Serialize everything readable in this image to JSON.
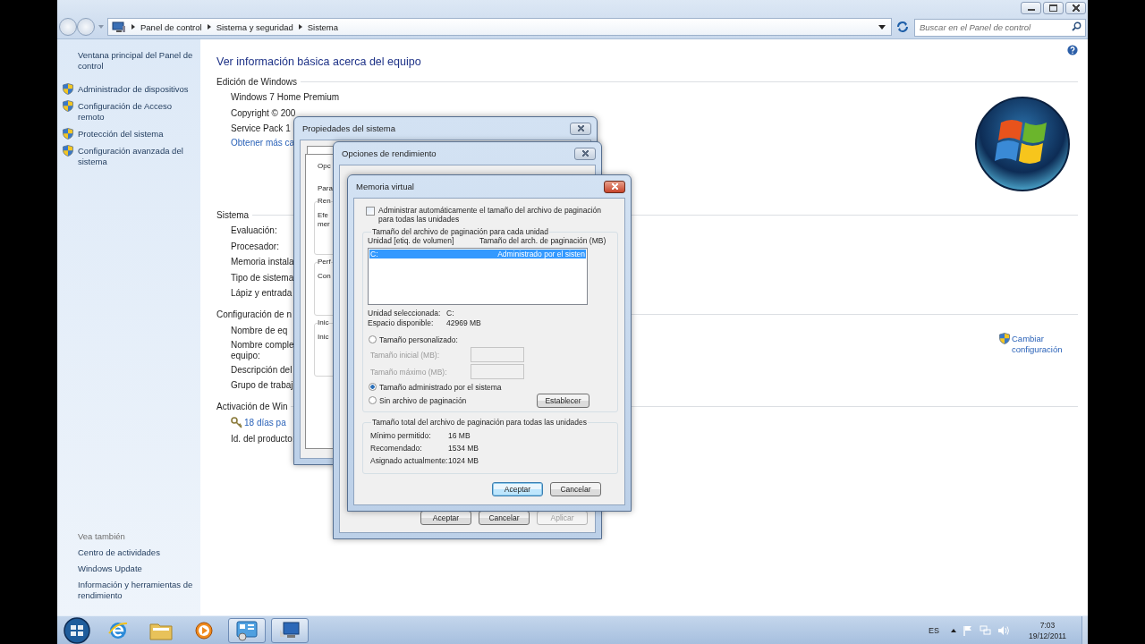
{
  "explorer": {
    "breadcrumb": [
      "Panel de control",
      "Sistema y seguridad",
      "Sistema"
    ],
    "search": {
      "placeholder": "Buscar en el Panel de control"
    }
  },
  "sidebar": {
    "home": "Ventana principal del Panel de control",
    "tasks": [
      "Administrador de dispositivos",
      "Configuración de Acceso remoto",
      "Protección del sistema",
      "Configuración avanzada del sistema"
    ],
    "see_also_title": "Vea también",
    "see_also": [
      "Centro de actividades",
      "Windows Update",
      "Información y herramientas de rendimiento"
    ]
  },
  "main": {
    "title": "Ver información básica acerca del equipo",
    "sections": [
      {
        "kind": "edition",
        "heading": "Edición de Windows",
        "rows": [
          {
            "kind": "text",
            "text": "Windows 7 Home Premium"
          },
          {
            "kind": "text",
            "text": "Copyright © 200"
          },
          {
            "kind": "text",
            "text": "Service Pack 1"
          },
          {
            "kind": "link",
            "text": "Obtener más ca"
          }
        ]
      },
      {
        "kind": "system",
        "heading": "Sistema",
        "rows": [
          {
            "kind": "text",
            "text": "Evaluación:"
          },
          {
            "kind": "text",
            "text": "Procesador:"
          },
          {
            "kind": "text",
            "text": "Memoria instala"
          },
          {
            "kind": "text",
            "text": "Tipo de sistema:"
          },
          {
            "kind": "text",
            "text": "Lápiz y entrada"
          }
        ]
      },
      {
        "kind": "computer",
        "heading": "Configuración de n",
        "action": "Cambiar configuración",
        "rows": [
          {
            "kind": "text",
            "text": "Nombre de eq"
          },
          {
            "kind": "text",
            "text": "Nombre comple\nequipo:"
          },
          {
            "kind": "text",
            "text": "Descripción del"
          },
          {
            "kind": "text",
            "text": "Grupo de trabaj"
          }
        ]
      },
      {
        "kind": "activation",
        "heading": "Activación de Win",
        "rows": [
          {
            "kind": "key-link",
            "text": "18 días pa"
          },
          {
            "kind": "text",
            "text": "Id. del producto:"
          }
        ]
      }
    ]
  },
  "dialogs": {
    "system_properties": {
      "title": "Propiedades del sistema",
      "lines": [
        "Opc",
        "Para"
      ],
      "groups": [
        {
          "legend": "Ren",
          "lines": [
            "Efe",
            "mer"
          ]
        },
        {
          "legend": "Perf",
          "lines": [
            "Con"
          ]
        },
        {
          "legend": "Inic",
          "lines": [
            "Inic"
          ]
        }
      ]
    },
    "performance": {
      "title": "Opciones de rendimiento",
      "buttons": [
        {
          "label": "Aceptar",
          "disabled": false
        },
        {
          "label": "Cancelar",
          "disabled": false
        },
        {
          "label": "Aplicar",
          "disabled": true
        }
      ]
    },
    "virtual_memory": {
      "title": "Memoria virtual",
      "auto_manage": {
        "label": "Administrar automáticamente el tamaño del archivo de paginación para todas las unidades",
        "checked": false
      },
      "per_drive": {
        "legend": "Tamaño del archivo de paginación para cada unidad",
        "columns": [
          "Unidad [etiq. de volumen]",
          "Tamaño del arch. de paginación (MB)"
        ],
        "rows": [
          {
            "drive": "C:",
            "size": "Administrado por el sisten",
            "selected": true
          }
        ],
        "info": [
          {
            "label": "Unidad seleccionada:",
            "value": "C:"
          },
          {
            "label": "Espacio disponible:",
            "value": "42969 MB"
          }
        ],
        "options": [
          {
            "kind": "radio",
            "label": "Tamaño personalizado:",
            "selected": false
          },
          {
            "kind": "field",
            "label": "Tamaño inicial (MB):",
            "disabled": true
          },
          {
            "kind": "field",
            "label": "Tamaño máximo (MB):",
            "disabled": true
          },
          {
            "kind": "radio",
            "label": "Tamaño administrado por el sistema",
            "selected": true
          },
          {
            "kind": "radio",
            "label": "Sin archivo de paginación",
            "selected": false
          }
        ],
        "set_button": "Establecer"
      },
      "totals": {
        "legend": "Tamaño total del archivo de paginación para todas las unidades",
        "rows": [
          {
            "label": "Mínimo permitido:",
            "value": "16 MB"
          },
          {
            "label": "Recomendado:",
            "value": "1534 MB"
          },
          {
            "label": "Asignado actualmente:",
            "value": "1024 MB"
          }
        ]
      },
      "buttons": [
        {
          "label": "Aceptar",
          "default": true
        },
        {
          "label": "Cancelar",
          "default": false
        }
      ]
    }
  },
  "taskbar": {
    "apps": [
      {
        "kind": "browser",
        "active": false
      },
      {
        "kind": "folder",
        "active": false
      },
      {
        "kind": "media",
        "active": false
      },
      {
        "kind": "control-panel",
        "active": true
      },
      {
        "kind": "system",
        "active": true
      }
    ],
    "language": "ES",
    "time": "7:03",
    "date": "19/12/2011"
  }
}
